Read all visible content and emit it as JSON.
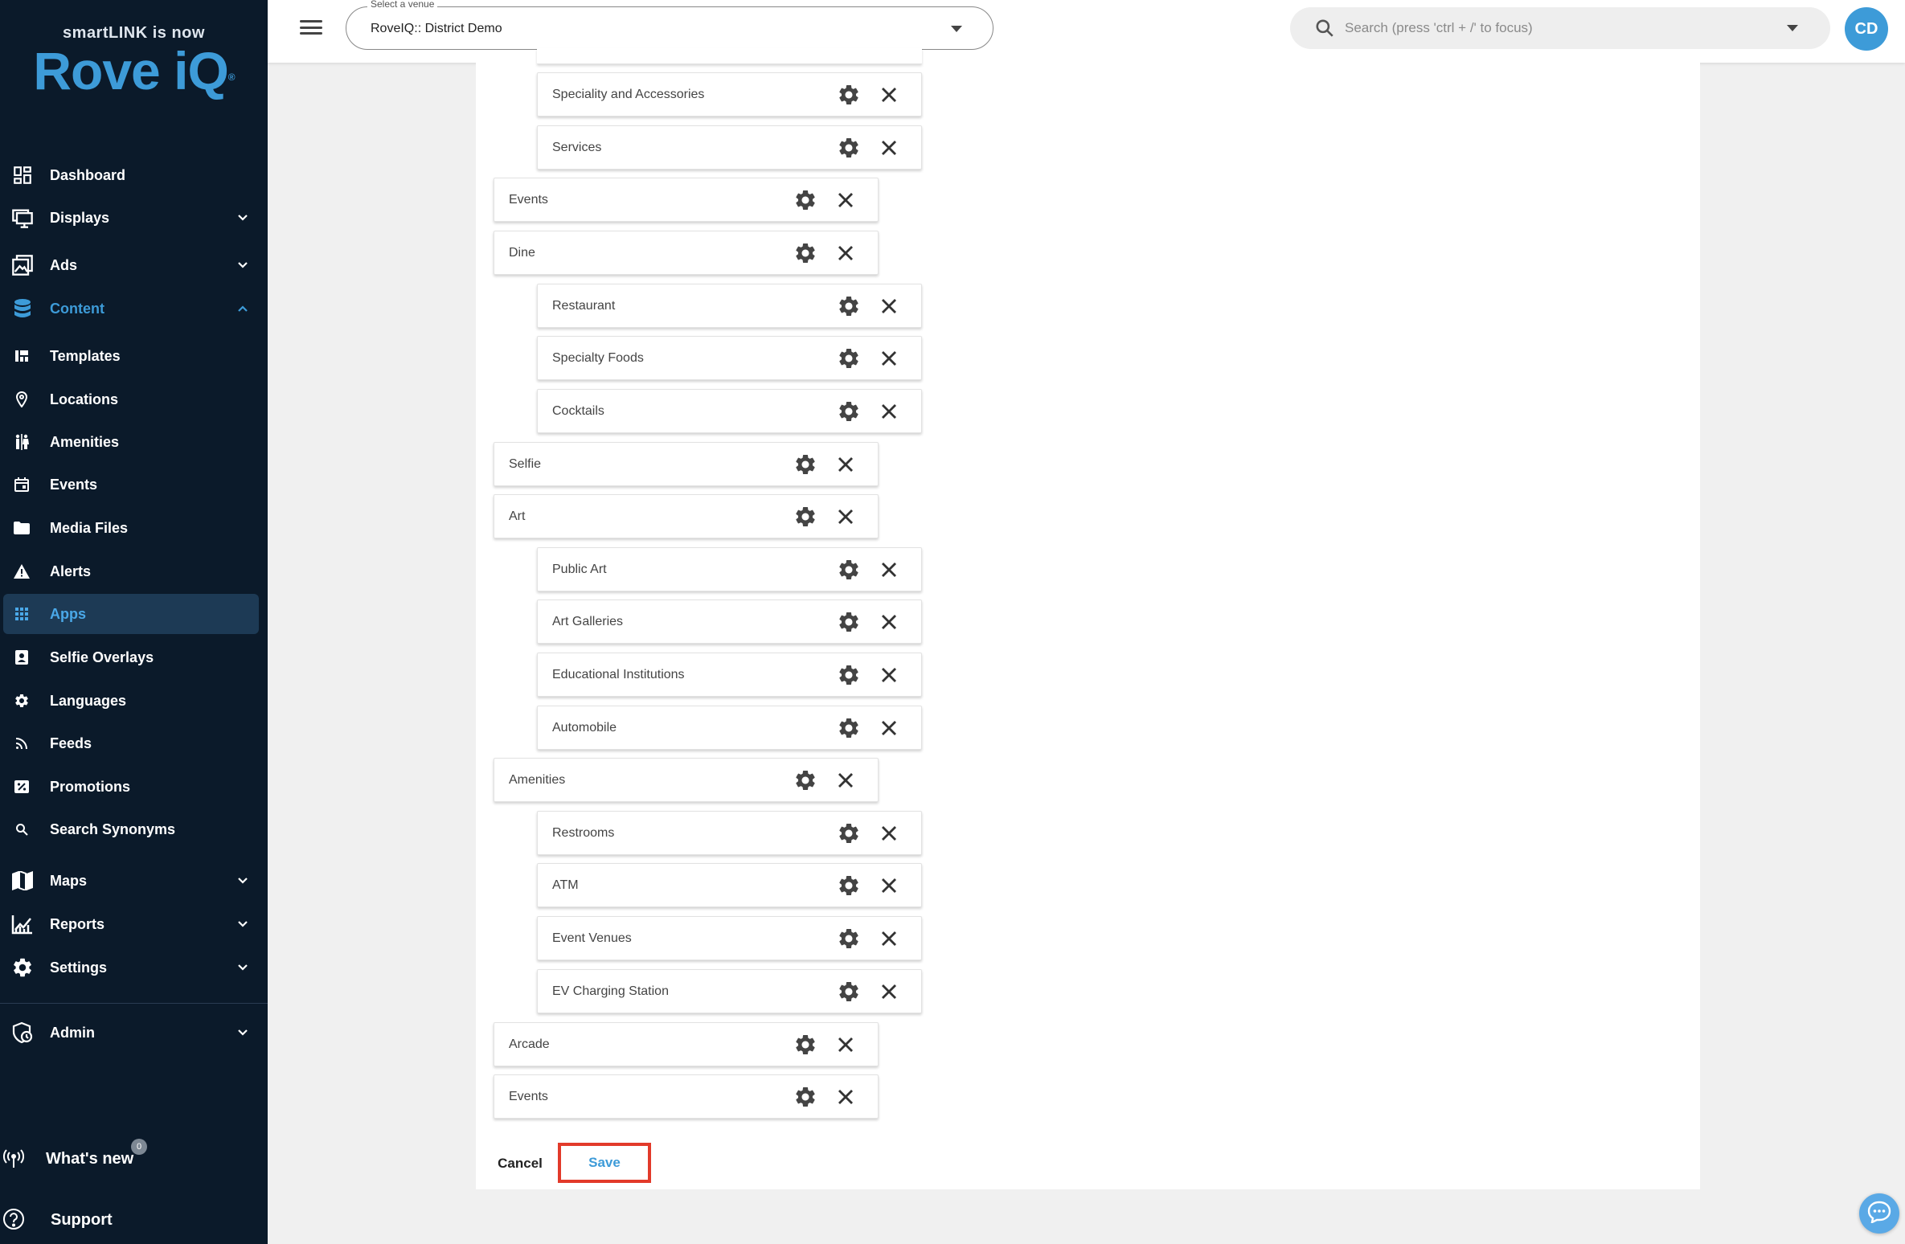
{
  "logo": {
    "top_text": "smartLINK is now",
    "brand": "Rove iQ",
    "mark": "®"
  },
  "nav": {
    "dashboard": "Dashboard",
    "displays": "Displays",
    "ads": "Ads",
    "content": "Content",
    "templates": "Templates",
    "locations": "Locations",
    "amenities": "Amenities",
    "events": "Events",
    "media_files": "Media Files",
    "alerts": "Alerts",
    "apps": "Apps",
    "selfie_overlays": "Selfie Overlays",
    "languages": "Languages",
    "feeds": "Feeds",
    "promotions": "Promotions",
    "search_synonyms": "Search Synonyms",
    "maps": "Maps",
    "reports": "Reports",
    "settings": "Settings",
    "admin": "Admin",
    "whats_new": "What's new",
    "whats_new_badge": "0",
    "support": "Support"
  },
  "topbar": {
    "venue_legend": "Select a venue",
    "venue_value": "RoveIQ:: District Demo",
    "search_placeholder": "Search (press 'ctrl + /' to focus)",
    "avatar_initials": "CD"
  },
  "items": [
    {
      "label": "Speciality and Accessories",
      "level": 2
    },
    {
      "label": "Services",
      "level": 2
    },
    {
      "label": "Events",
      "level": 1
    },
    {
      "label": "Dine",
      "level": 1
    },
    {
      "label": "Restaurant",
      "level": 2
    },
    {
      "label": "Specialty Foods",
      "level": 2
    },
    {
      "label": "Cocktails",
      "level": 2
    },
    {
      "label": "Selfie",
      "level": 1
    },
    {
      "label": "Art",
      "level": 1
    },
    {
      "label": "Public Art",
      "level": 2
    },
    {
      "label": "Art Galleries",
      "level": 2
    },
    {
      "label": "Educational Institutions",
      "level": 2
    },
    {
      "label": "Automobile",
      "level": 2
    },
    {
      "label": "Amenities",
      "level": 1
    },
    {
      "label": "Restrooms",
      "level": 2
    },
    {
      "label": "ATM",
      "level": 2
    },
    {
      "label": "Event Venues",
      "level": 2
    },
    {
      "label": "EV Charging Station",
      "level": 2
    },
    {
      "label": "Arcade",
      "level": 1
    },
    {
      "label": "Events",
      "level": 1
    }
  ],
  "actions": {
    "cancel": "Cancel",
    "save": "Save"
  },
  "colors": {
    "accent": "#3d9bd8",
    "sidebar_bg": "#0b1a2a",
    "highlight": "#e23a2a"
  }
}
